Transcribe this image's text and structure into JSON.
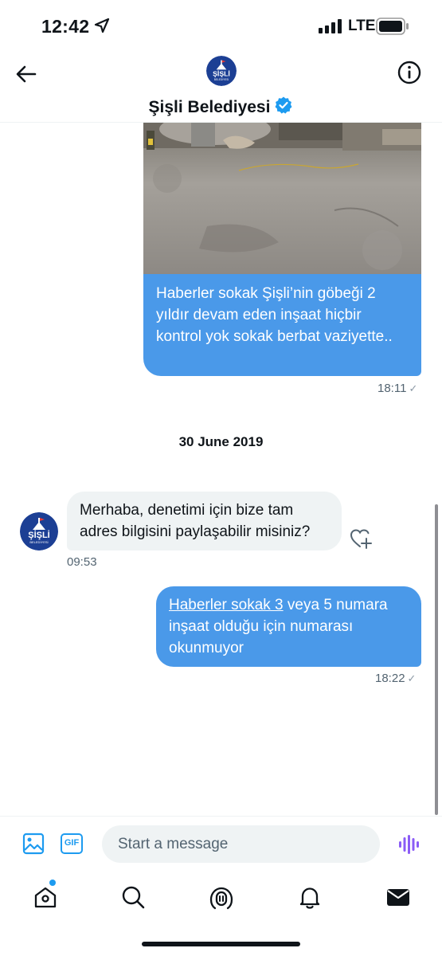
{
  "status_bar": {
    "time": "12:42",
    "network": "LTE"
  },
  "header": {
    "title": "Şişli Belediyesi",
    "verified": true,
    "logo_text": "ŞİŞLİ",
    "logo_subtext": "BELEDİYESİ"
  },
  "messages": [
    {
      "direction": "sent",
      "has_photo": true,
      "text": "Haberler sokak Şişli’nin göbeği 2 yıldır devam eden inşaat hiçbir kontrol yok sokak berbat vaziyette..",
      "time": "18:11",
      "status": "✓"
    },
    {
      "type": "date",
      "text": "30 June 2019"
    },
    {
      "direction": "received",
      "text": "Merhaba, denetimi için bize tam adres bilgisini paylaşabilir misiniz?",
      "time": "09:53"
    },
    {
      "direction": "sent",
      "link_text": "Haberler sokak 3",
      "text": " veya 5 numara inşaat olduğu için numarası okunmuyor",
      "time": "18:22",
      "status": "✓"
    }
  ],
  "composer": {
    "placeholder": "Start a message",
    "gif_label": "GIF"
  },
  "icons": {
    "back": "arrow-left-icon",
    "info": "info-icon",
    "media": "image-icon",
    "voice": "voice-wave-icon",
    "reaction": "heart-plus-icon",
    "tabs": [
      "home-icon",
      "search-icon",
      "spaces-icon",
      "notifications-icon",
      "messages-icon"
    ]
  },
  "colors": {
    "sent_bubble": "#4a99e9",
    "received_bubble": "#eff3f4",
    "accent": "#1d9bf0",
    "voice_accent": "#8b5cf6",
    "logo_blue": "#1c3f94"
  },
  "tabbar": {
    "active": "messages",
    "home_has_badge": true
  }
}
